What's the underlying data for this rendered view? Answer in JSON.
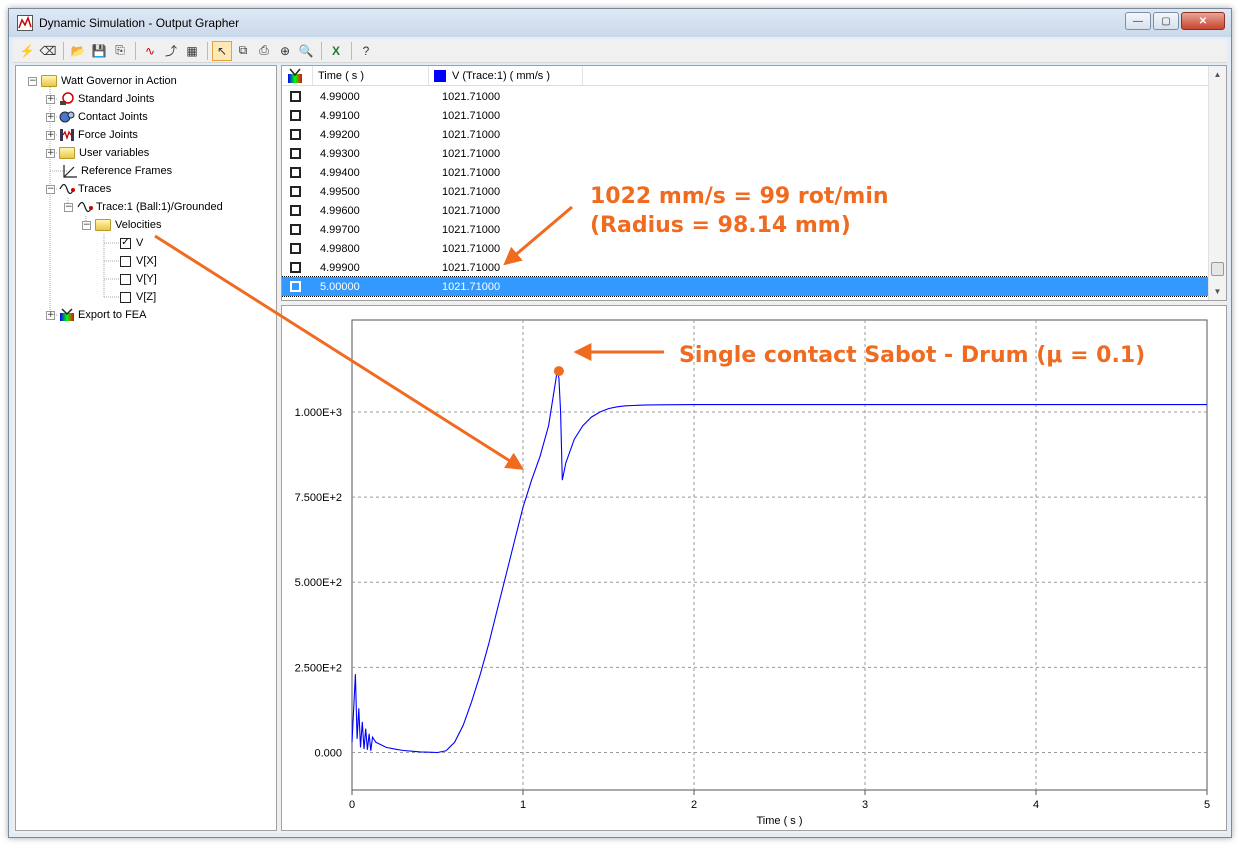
{
  "window": {
    "title": "Dynamic Simulation - Output Grapher"
  },
  "tree": {
    "root": "Watt Governor in Action",
    "items": [
      {
        "label": "Standard Joints"
      },
      {
        "label": "Contact Joints"
      },
      {
        "label": "Force Joints"
      },
      {
        "label": "User variables"
      },
      {
        "label": "Reference Frames"
      },
      {
        "label": "Traces"
      },
      {
        "label": "Trace:1 (Ball:1)/Grounded"
      },
      {
        "label": "Velocities"
      },
      {
        "label": "V"
      },
      {
        "label": "V[X]"
      },
      {
        "label": "V[Y]"
      },
      {
        "label": "V[Z]"
      },
      {
        "label": "Export to FEA"
      }
    ]
  },
  "table": {
    "columns": [
      "Time ( s )",
      "V (Trace:1) ( mm/s )"
    ],
    "series_color": "#0000ff",
    "rows": [
      [
        "4.99000",
        "1021.71000"
      ],
      [
        "4.99100",
        "1021.71000"
      ],
      [
        "4.99200",
        "1021.71000"
      ],
      [
        "4.99300",
        "1021.71000"
      ],
      [
        "4.99400",
        "1021.71000"
      ],
      [
        "4.99500",
        "1021.71000"
      ],
      [
        "4.99600",
        "1021.71000"
      ],
      [
        "4.99700",
        "1021.71000"
      ],
      [
        "4.99800",
        "1021.71000"
      ],
      [
        "4.99900",
        "1021.71000"
      ],
      [
        "5.00000",
        "1021.71000"
      ]
    ],
    "selected_row": 10
  },
  "annotations": {
    "speed_line1": "1022 mm/s = 99 rot/min",
    "speed_line2": "(Radius = 98.14 mm)",
    "contact": "Single contact Sabot - Drum (μ = 0.1)",
    "color": "#f06a1f"
  },
  "chart_data": {
    "type": "line",
    "xlabel": "Time ( s )",
    "ylabel": "",
    "xlim": [
      0,
      5
    ],
    "ylim": [
      -110,
      1270
    ],
    "xticks": [
      "0",
      "1",
      "2",
      "3",
      "4",
      "5"
    ],
    "yticks": [
      "0.000",
      "2.500E+2",
      "5.000E+2",
      "7.500E+2",
      "1.000E+3"
    ],
    "ytick_values": [
      0,
      250,
      500,
      750,
      1000
    ],
    "grid": true,
    "line_color": "#0000ff",
    "series": [
      {
        "x": [
          0,
          0.02,
          0.03,
          0.04,
          0.05,
          0.06,
          0.07,
          0.08,
          0.09,
          0.1,
          0.11,
          0.12,
          0.14,
          0.16,
          0.2,
          0.25,
          0.3,
          0.35,
          0.4,
          0.45,
          0.5,
          0.55,
          0.6,
          0.65,
          0.7,
          0.75,
          0.8,
          0.85,
          0.9,
          0.95,
          1.0,
          1.05,
          1.1,
          1.15,
          1.2,
          1.21,
          1.22,
          1.23,
          1.25,
          1.3,
          1.35,
          1.4,
          1.45,
          1.5,
          1.55,
          1.6,
          1.7,
          1.8,
          2.0,
          2.5,
          3.0,
          3.5,
          4.0,
          4.5,
          5.0
        ],
        "y": [
          30,
          230,
          40,
          130,
          15,
          90,
          10,
          70,
          8,
          55,
          5,
          45,
          30,
          25,
          15,
          10,
          6,
          4,
          2,
          1,
          0,
          5,
          30,
          80,
          150,
          230,
          320,
          420,
          520,
          620,
          720,
          800,
          870,
          960,
          1120,
          1100,
          1000,
          800,
          850,
          920,
          960,
          985,
          1000,
          1010,
          1015,
          1018,
          1020,
          1021,
          1021.5,
          1021.7,
          1021.7,
          1021.7,
          1021.7,
          1021.7,
          1021.7
        ]
      }
    ],
    "marker": {
      "x": 1.21,
      "y": 1120
    }
  }
}
